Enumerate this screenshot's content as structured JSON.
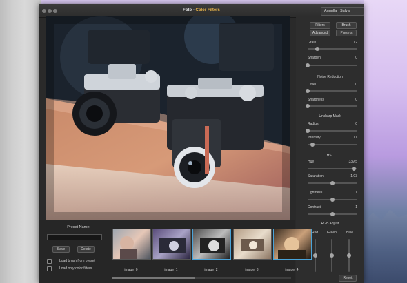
{
  "window": {
    "app_name": "Foto",
    "separator": " - ",
    "doc_title": "Color Filters",
    "cancel_button": "Annulla",
    "save_button": "Salva modifiche"
  },
  "panel": {
    "tabs": [
      "Filters",
      "Brush",
      "Advanced",
      "Presets"
    ],
    "sliders_top": [
      {
        "label": "Grain",
        "value": "0,2",
        "fraction": 0.2
      },
      {
        "label": "Sharpen",
        "value": "0",
        "fraction": 0.0
      }
    ],
    "noise_reduction": {
      "title": "Noise Reduction",
      "sliders": [
        {
          "label": "Level",
          "value": "0",
          "fraction": 0.0
        },
        {
          "label": "Sharpness",
          "value": "0",
          "fraction": 0.0
        }
      ]
    },
    "unsharp_mask": {
      "title": "Unsharp Mask",
      "sliders": [
        {
          "label": "Radius",
          "value": "0",
          "fraction": 0.0
        },
        {
          "label": "Intensity",
          "value": "0,1",
          "fraction": 0.1
        }
      ]
    },
    "hsl": {
      "title": "HSL",
      "sliders": [
        {
          "label": "Hue",
          "value": "339,5",
          "fraction": 0.93
        },
        {
          "label": "Saturation",
          "value": "1,03",
          "fraction": 0.5
        },
        {
          "label": "Lightness",
          "value": "1",
          "fraction": 0.5
        },
        {
          "label": "Contrast",
          "value": "1",
          "fraction": 0.5
        }
      ]
    },
    "rgb": {
      "title": "RGB Adjust",
      "channels": [
        {
          "label": "Red",
          "fraction": 0.5
        },
        {
          "label": "Green",
          "fraction": 0.5
        },
        {
          "label": "Blue",
          "fraction": 0.5
        }
      ],
      "reset_button": "Reset"
    }
  },
  "preset": {
    "name_label": "Preset Name:",
    "name_value": "",
    "save_button": "Save",
    "delete_button": "Delete",
    "checkbox_brush": "Load brush from preset",
    "checkbox_color": "Load only color filters"
  },
  "thumbnails": [
    {
      "label": "image_0",
      "selected": false
    },
    {
      "label": "image_1",
      "selected": false
    },
    {
      "label": "image_2",
      "selected": true
    },
    {
      "label": "image_3",
      "selected": false
    },
    {
      "label": "image_4",
      "selected": true
    }
  ]
}
